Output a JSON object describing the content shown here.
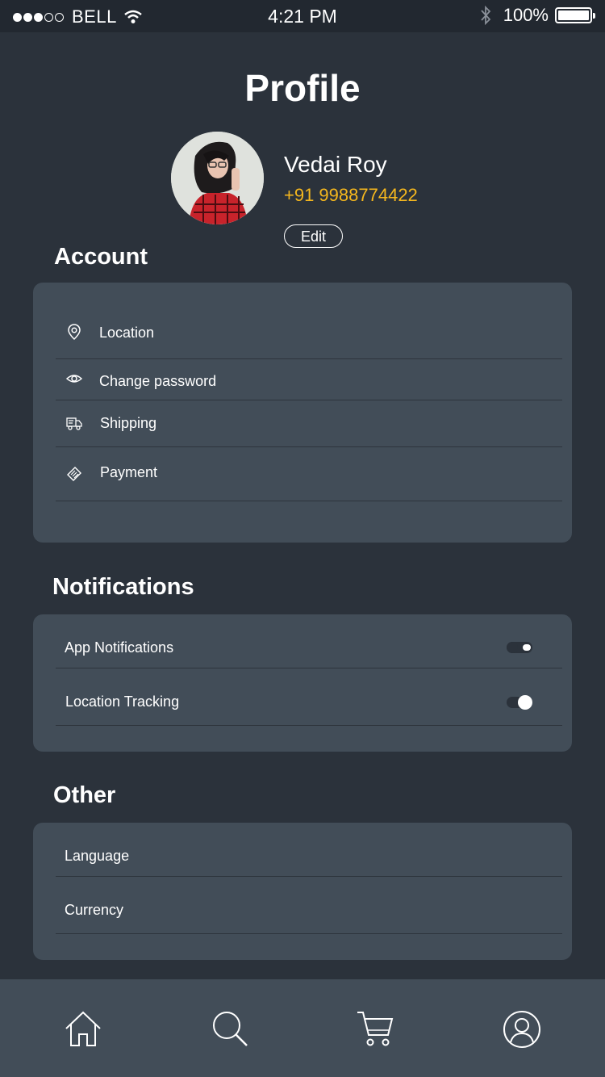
{
  "status_bar": {
    "carrier": "BELL",
    "time": "4:21 PM",
    "battery": "100%"
  },
  "page": {
    "title": "Profile"
  },
  "profile": {
    "name": "Vedai Roy",
    "phone": "+91 9988774422",
    "edit_label": "Edit"
  },
  "account": {
    "title": "Account",
    "items": [
      {
        "label": "Location",
        "icon": "location-pin-icon"
      },
      {
        "label": "Change password",
        "icon": "eye-icon"
      },
      {
        "label": "Shipping",
        "icon": "delivery-truck-icon"
      },
      {
        "label": "Payment",
        "icon": "card-tag-icon"
      }
    ]
  },
  "notifications": {
    "title": "Notifications",
    "items": [
      {
        "label": "App Notifications",
        "enabled": false
      },
      {
        "label": "Location Tracking",
        "enabled": true
      }
    ]
  },
  "other": {
    "title": "Other",
    "items": [
      {
        "label": "Language"
      },
      {
        "label": "Currency"
      }
    ]
  },
  "bottom_nav": [
    {
      "name": "home",
      "icon": "home-icon"
    },
    {
      "name": "search",
      "icon": "search-icon"
    },
    {
      "name": "cart",
      "icon": "cart-icon"
    },
    {
      "name": "profile",
      "icon": "user-icon"
    }
  ],
  "colors": {
    "background": "#2b323b",
    "card": "#424d58",
    "accent_phone": "#f5b71e",
    "status_bar": "#222830"
  }
}
